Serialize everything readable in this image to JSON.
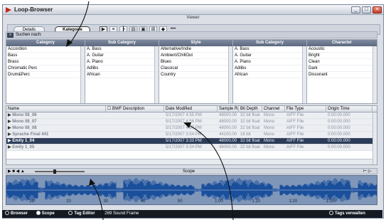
{
  "window": {
    "title": "Loop-Browser",
    "viewer_label": "Viewer",
    "minimize_label": "_",
    "maximize_label": "□",
    "close_label": "✕"
  },
  "tabs": [
    {
      "label": "Details"
    },
    {
      "label": "Kategorie"
    }
  ],
  "toolbar": {
    "icons": [
      "play-icon",
      "filter-icon",
      "columns-icon",
      "list-icon",
      "folder-icon",
      "grid-icon",
      "speaker-icon",
      "ellipsis-icon"
    ],
    "extra_label": "•••"
  },
  "search": {
    "label": "Suchen nach:",
    "icon": "search-icon"
  },
  "filter_columns": [
    {
      "header": "Category",
      "items": [
        "Accordion",
        "Bass",
        "Brass",
        "Chromatic Perc",
        "Drum&Perc"
      ]
    },
    {
      "header": "Sub Category",
      "items": [
        "A. Bass",
        "A. Guitar",
        "A. Piano",
        "Adlibs",
        "African"
      ]
    },
    {
      "header": "Style",
      "items": [
        "Alternative/Indie",
        "Ambient/ChillOut",
        "Blues",
        "Classical",
        "Country"
      ]
    },
    {
      "header": "Sub Category",
      "items": [
        "A. Bass",
        "A. Guitar",
        "A. Piano",
        "Adlibs",
        "African"
      ]
    },
    {
      "header": "Character",
      "items": [
        "Acoustic",
        "Bright",
        "Clean",
        "Dark",
        "Dissonant"
      ]
    }
  ],
  "results": {
    "columns": [
      "Name",
      "BWF Description",
      "Date Modified",
      "Sample Rate",
      "Bit Depth",
      "Channel",
      "File Type",
      "Origin Time"
    ],
    "rows": [
      {
        "name": "Mono 08_06",
        "date": "5/17/2007 4:55 PM",
        "rate": "48000.00",
        "bits": "32 bit float",
        "channel": "Mono",
        "type": "AIFF File",
        "origin": "0:00:00.000"
      },
      {
        "name": "Mono 08_07",
        "date": "5/17/2007 4:56 PM",
        "rate": "48000.00",
        "bits": "32 bit float",
        "channel": "Mono",
        "type": "AIFF File",
        "origin": "0:00:00.000"
      },
      {
        "name": "Mono 08_08",
        "date": "5/17/2007 4:57 PM",
        "rate": "48000.00",
        "bits": "32 bit float",
        "channel": "Mono",
        "type": "AIFF File",
        "origin": "0:00:00.000"
      },
      {
        "name": "Sprache Final 441",
        "date": "5/17/2007 3:54 PM",
        "rate": "44100.00",
        "bits": "16 bit",
        "channel": "Mono",
        "type": "AIFF File",
        "origin": "0:00:00.000"
      },
      {
        "name": "Emily 1_04",
        "date": "5/17/2007 3:33 PM",
        "rate": "48000.00",
        "bits": "32 bit float",
        "channel": "Mono",
        "type": "AIFF File",
        "origin": "0:00:00.000",
        "selected": true
      },
      {
        "name": "Emily 1_05",
        "date": "5/17/2007 3:34 PM",
        "rate": "48000.00",
        "bits": "32 bit float",
        "channel": "Mono",
        "type": "AIFF File",
        "origin": "0:00:00.000"
      }
    ]
  },
  "scope": {
    "label": "Scope",
    "ticks": [
      "10",
      "20",
      "30",
      "40",
      "50",
      "1:00",
      "1:10",
      "1:20",
      "1:30"
    ]
  },
  "status": {
    "browser": "Browser",
    "scope": "Scope",
    "tag_editor": "Tag Editor",
    "info": "269 Sound Frame",
    "tags_manage": "Tags verwalten"
  }
}
